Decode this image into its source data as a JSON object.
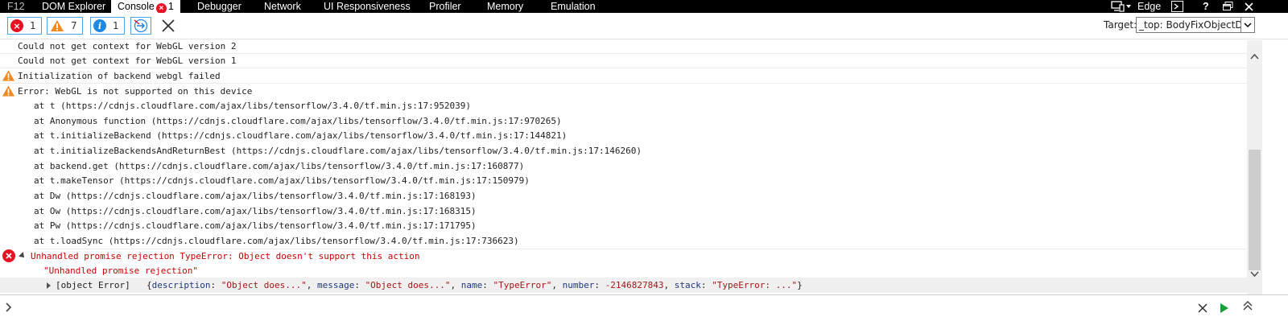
{
  "tabs": [
    {
      "label": "F12"
    },
    {
      "label": "DOM Explorer"
    },
    {
      "label": "Console",
      "error_count": "1"
    },
    {
      "label": "Debugger"
    },
    {
      "label": "Network"
    },
    {
      "label": "UI Responsiveness"
    },
    {
      "label": "Profiler"
    },
    {
      "label": "Memory"
    },
    {
      "label": "Emulation"
    }
  ],
  "browser_mode": "Edge",
  "filters": {
    "errors": "1",
    "warnings": "7",
    "messages": "1"
  },
  "target": {
    "label": "Target:",
    "value": "_top: BodyFixObjectDet"
  },
  "console": {
    "lines": [
      {
        "text": "Could not get context for WebGL version 2"
      },
      {
        "text": "Could not get context for WebGL version 1"
      },
      {
        "text": "Initialization of backend webgl failed"
      },
      {
        "text": "Error: WebGL is not supported on this device"
      }
    ],
    "stack": [
      "at t (https://cdnjs.cloudflare.com/ajax/libs/tensorflow/3.4.0/tf.min.js:17:952039)",
      "at Anonymous function (https://cdnjs.cloudflare.com/ajax/libs/tensorflow/3.4.0/tf.min.js:17:970265)",
      "at t.initializeBackend (https://cdnjs.cloudflare.com/ajax/libs/tensorflow/3.4.0/tf.min.js:17:144821)",
      "at t.initializeBackendsAndReturnBest (https://cdnjs.cloudflare.com/ajax/libs/tensorflow/3.4.0/tf.min.js:17:146260)",
      "at backend.get (https://cdnjs.cloudflare.com/ajax/libs/tensorflow/3.4.0/tf.min.js:17:160877)",
      "at t.makeTensor (https://cdnjs.cloudflare.com/ajax/libs/tensorflow/3.4.0/tf.min.js:17:150979)",
      "at Dw (https://cdnjs.cloudflare.com/ajax/libs/tensorflow/3.4.0/tf.min.js:17:168193)",
      "at Ow (https://cdnjs.cloudflare.com/ajax/libs/tensorflow/3.4.0/tf.min.js:17:168315)",
      "at Pw (https://cdnjs.cloudflare.com/ajax/libs/tensorflow/3.4.0/tf.min.js:17:171795)",
      "at t.loadSync (https://cdnjs.cloudflare.com/ajax/libs/tensorflow/3.4.0/tf.min.js:17:736623)"
    ],
    "rejection": {
      "header": "Unhandled promise rejection TypeError: Object doesn't support this action",
      "string": "\"Unhandled promise rejection\"",
      "object_label": "[object Error]",
      "props": [
        {
          "key": "description",
          "value": "\"Object does...\""
        },
        {
          "key": "message",
          "value": "\"Object does...\""
        },
        {
          "key": "name",
          "value": "\"TypeError\""
        },
        {
          "key": "number",
          "value": "-2146827843"
        },
        {
          "key": "stack",
          "value": "\"TypeError: ...\""
        }
      ]
    }
  },
  "icons": {
    "error": "error-circle-icon",
    "warning": "warning-triangle-icon",
    "info": "info-circle-icon",
    "clear_on_navigate": "clear-on-navigate-icon",
    "clear": "clear-console-icon"
  },
  "colors": {
    "error": "#e81123",
    "warning": "#ef8a22",
    "info": "#1e88e5",
    "tabbar": "#000000"
  }
}
